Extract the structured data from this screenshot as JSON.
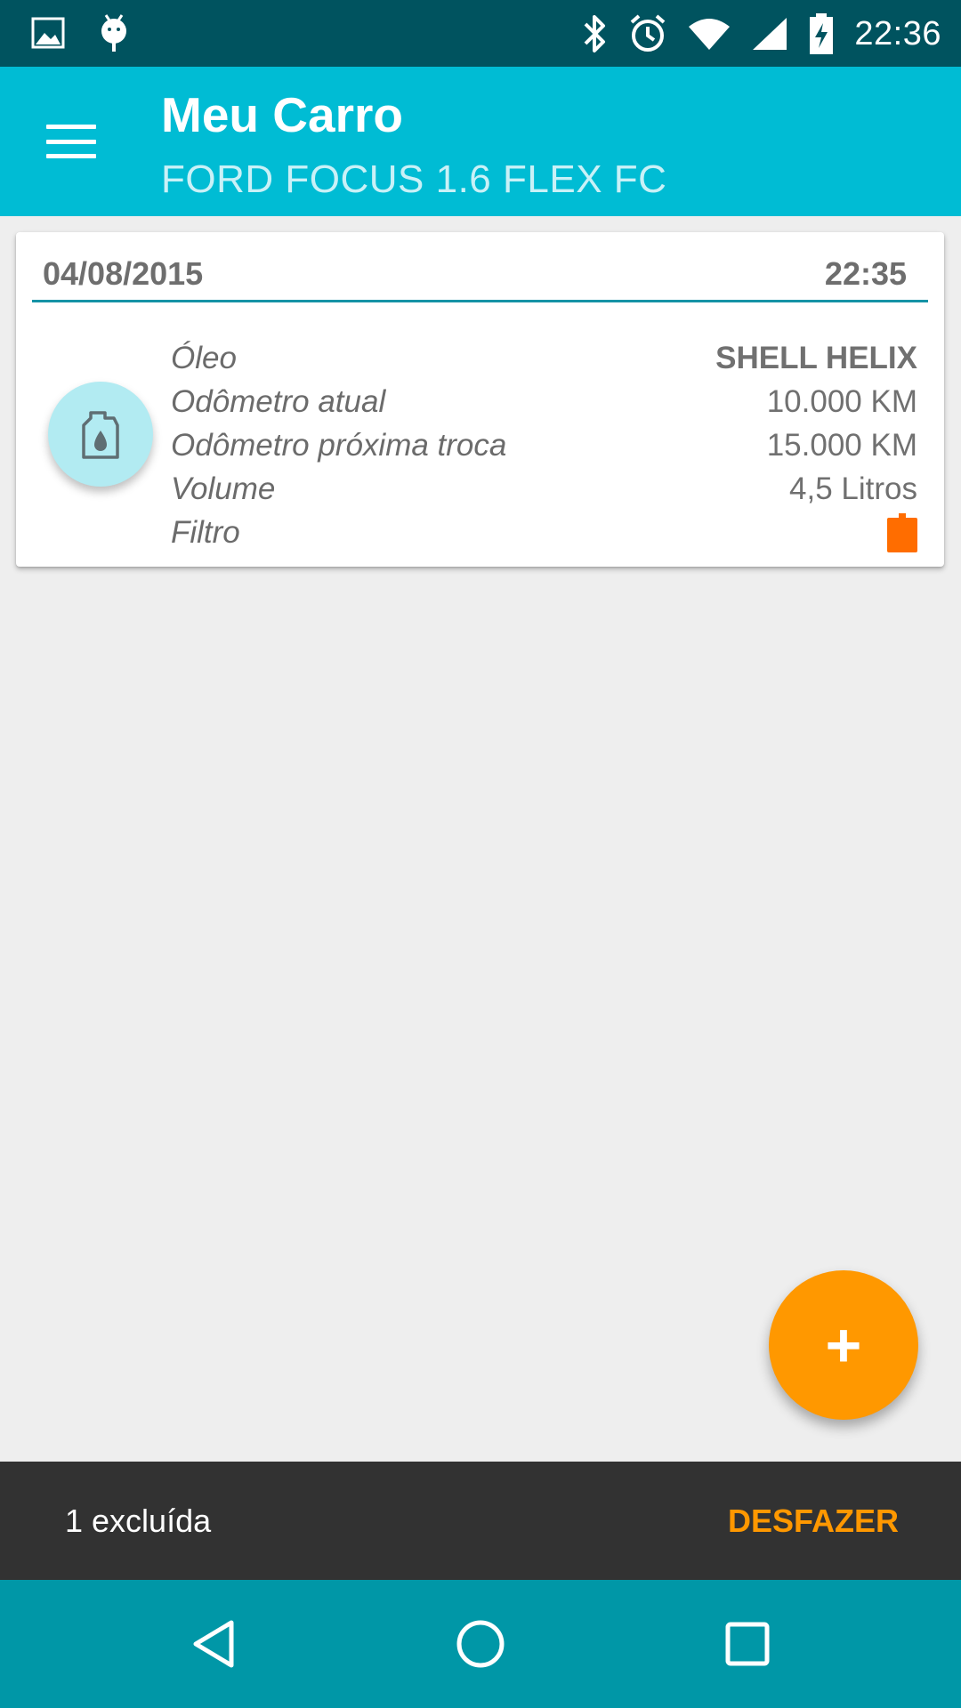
{
  "status_bar": {
    "time": "22:36",
    "icons": [
      "image-icon",
      "android-debug-icon",
      "bluetooth-icon",
      "alarm-icon",
      "wifi-icon",
      "signal-icon",
      "battery-charging-icon"
    ]
  },
  "app_bar": {
    "title": "Meu Carro",
    "subtitle": "FORD FOCUS 1.6 FLEX FC",
    "menu_icon": "menu-icon",
    "color": "#00bcd4"
  },
  "card": {
    "date": "04/08/2015",
    "time": "22:35",
    "icon": "oil-bottle-icon",
    "rows": [
      {
        "label": "Óleo",
        "value": "SHELL HELIX"
      },
      {
        "label": "Odômetro atual",
        "value": "10.000 KM"
      },
      {
        "label": "Odômetro próxima troca",
        "value": "15.000 KM"
      },
      {
        "label": "Volume",
        "value": "4,5 Litros"
      },
      {
        "label": "Filtro",
        "value_icon": "filter-icon",
        "value_color": "#ff6d00"
      }
    ]
  },
  "fab": {
    "label": "+",
    "color": "#ff9800"
  },
  "snackbar": {
    "message": "1 excluída",
    "action": "DESFAZER",
    "action_color": "#ff9800"
  },
  "nav_bar": {
    "buttons": [
      "back-icon",
      "home-icon",
      "recents-icon"
    ],
    "color": "#0097a7"
  }
}
